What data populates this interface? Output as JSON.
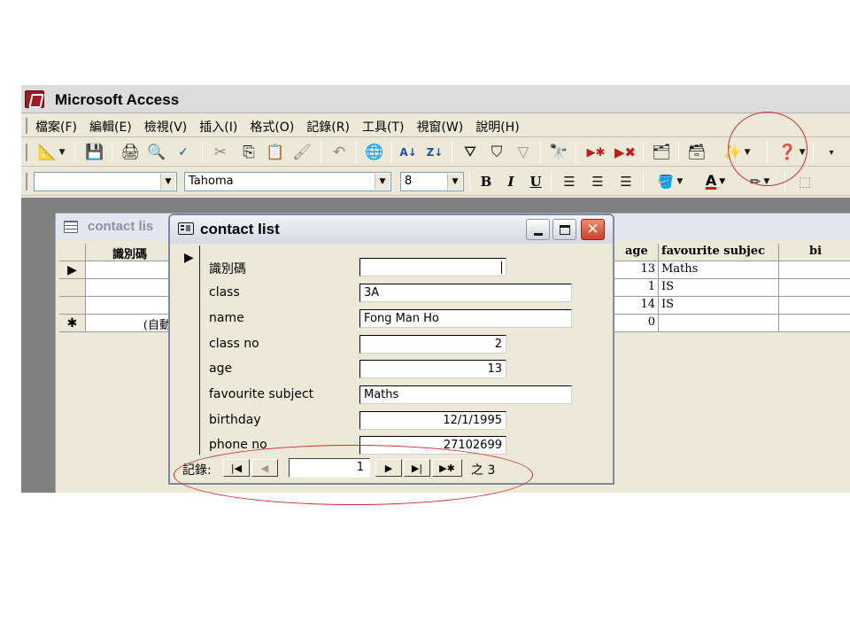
{
  "app": {
    "title": "Microsoft Access"
  },
  "menu": [
    "檔案(F)",
    "編輯(E)",
    "檢視(V)",
    "插入(I)",
    "格式(O)",
    "記錄(R)",
    "工具(T)",
    "視窗(W)",
    "說明(H)"
  ],
  "toolbar1": [
    "design-view-icon",
    "save-icon",
    "print-icon",
    "print-preview-icon",
    "spelling-icon",
    "cut-icon",
    "copy-icon",
    "paste-icon",
    "format-painter-icon",
    "undo-icon",
    "hyperlink-icon",
    "sort-ascending-icon",
    "sort-descending-icon",
    "filter-by-selection-icon",
    "filter-by-form-icon",
    "apply-filter-icon",
    "find-icon",
    "new-record-icon",
    "delete-record-icon",
    "properties-icon",
    "database-window-icon",
    "new-object-icon",
    "help-icon"
  ],
  "toolbar2": {
    "object_combo": "",
    "font_name": "Tahoma",
    "font_size": "8",
    "bold": "B",
    "italic": "I",
    "underline": "U"
  },
  "datasheet": {
    "title": "contact lis",
    "columns": [
      "識別碼",
      "age",
      "favourite subjec",
      "bi"
    ],
    "rows": [
      {
        "selector": "▶",
        "id": "",
        "age": "13",
        "subject": "Maths"
      },
      {
        "selector": "",
        "id": "",
        "age": "1",
        "subject": "IS"
      },
      {
        "selector": "",
        "id": "",
        "age": "14",
        "subject": "IS"
      },
      {
        "selector": "✱",
        "id": "(自動",
        "age": "0",
        "subject": ""
      }
    ]
  },
  "form": {
    "title": "contact list",
    "fields": [
      {
        "label": "識別碼",
        "value": ""
      },
      {
        "label": "class",
        "value": "3A"
      },
      {
        "label": "name",
        "value": "Fong Man Ho"
      },
      {
        "label": "class no",
        "value": "2"
      },
      {
        "label": "age",
        "value": "13"
      },
      {
        "label": "favourite subject",
        "value": "Maths"
      },
      {
        "label": "birthday",
        "value": "12/1/1995"
      },
      {
        "label": "phone no",
        "value": "27102699"
      }
    ],
    "nav": {
      "label": "記錄:",
      "current": "1",
      "of_text": "之 3"
    }
  },
  "colors": {
    "annotation": "#d42a2a",
    "workspace": "#808080",
    "chrome": "#ece9d8"
  }
}
